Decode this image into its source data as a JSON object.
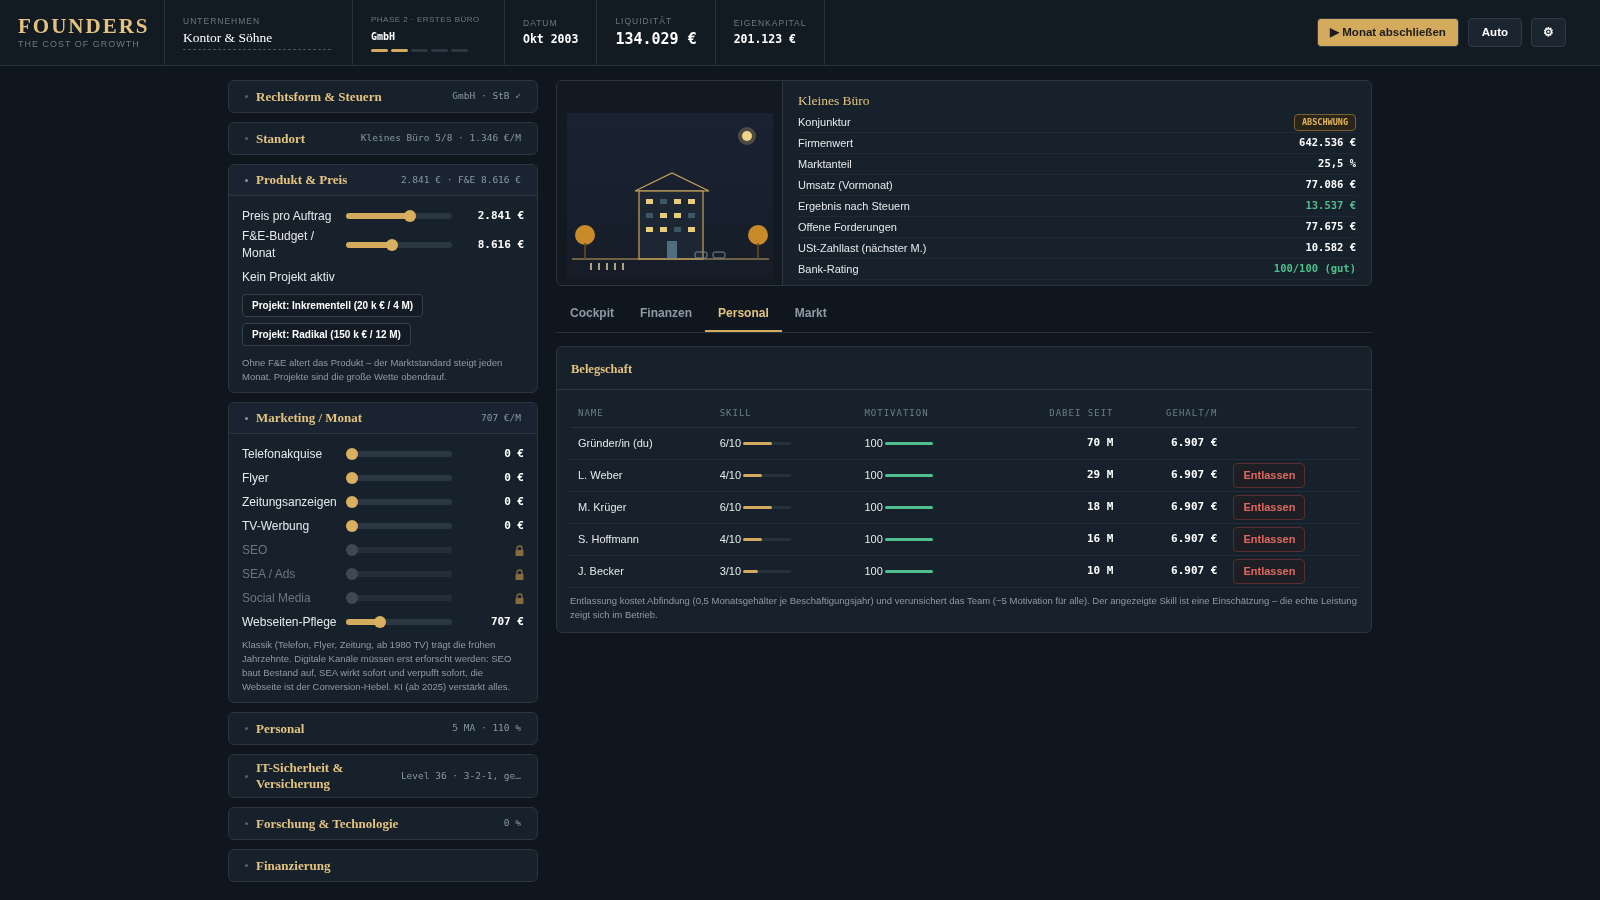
{
  "header": {
    "logo": {
      "title": "FOUNDERS",
      "subtitle": "THE COST OF GROWTH"
    },
    "company": {
      "label": "UNTERNEHMEN",
      "value": "Kontor & Söhne"
    },
    "phase": {
      "label": "PHASE 2 · ERSTES BÜRO",
      "value": "GmbH",
      "steps": [
        {
          "done": true
        },
        {
          "done": true
        },
        {
          "done": false
        },
        {
          "done": false
        },
        {
          "done": false
        }
      ]
    },
    "stats": [
      {
        "label": "DATUM",
        "value": "Okt 2003",
        "kind": "normal"
      },
      {
        "label": "LIQUIDITÄT",
        "value": "134.029 €",
        "kind": "large"
      },
      {
        "label": "EIGENKAPITAL",
        "value": "201.123 €",
        "kind": "normal"
      }
    ],
    "actions": [
      {
        "label": "▶ Monat abschließen",
        "kind": "primary"
      },
      {
        "label": "Auto",
        "kind": "secondary"
      },
      {
        "label": "⚙",
        "kind": "icon"
      }
    ]
  },
  "sidebar": {
    "sections": [
      {
        "title": "Rechtsform & Steuern",
        "summary": "GmbH · StB ✓",
        "expanded": false
      },
      {
        "title": "Standort",
        "summary": "Kleines Büro 5/8 · 1.346 €/M",
        "expanded": false
      },
      {
        "title": "Produkt & Preis",
        "summary": "2.841 € · F&E 8.616 €",
        "expanded": true,
        "sliders": [
          {
            "label": "Preis pro Auftrag",
            "level": 0.62,
            "value": "2.841 €",
            "kind": "active"
          },
          {
            "label": "F&E-Budget / Monat",
            "level": 0.43,
            "value": "8.616 €",
            "kind": "active"
          }
        ],
        "status": "Kein Projekt aktiv",
        "buttons": [
          "Projekt: Inkrementell (20 k € / 4 M)",
          "Projekt: Radikal (150 k € / 12 M)"
        ],
        "note": "Ohne F&E altert das Produkt – der Marktstandard steigt jeden Monat. Projekte sind die große Wette obendrauf."
      },
      {
        "title": "Marketing / Monat",
        "summary": "707 €/M",
        "expanded": true,
        "sliders": [
          {
            "label": "Telefonakquise",
            "level": 0,
            "value": "0 €",
            "kind": "active"
          },
          {
            "label": "Flyer",
            "level": 0,
            "value": "0 €",
            "kind": "active"
          },
          {
            "label": "Zeitungsanzeigen",
            "level": 0,
            "value": "0 €",
            "kind": "active"
          },
          {
            "label": "TV-Werbung",
            "level": 0,
            "value": "0 €",
            "kind": "active"
          },
          {
            "label": "SEO",
            "level": 0,
            "kind": "locked"
          },
          {
            "label": "SEA / Ads",
            "level": 0,
            "kind": "locked"
          },
          {
            "label": "Social Media",
            "level": 0,
            "kind": "locked"
          },
          {
            "label": "Webseiten-Pflege",
            "level": 0.3,
            "value": "707 €",
            "kind": "active"
          }
        ],
        "note": "Klassik (Telefon, Flyer, Zeitung, ab 1980 TV) trägt die frühen Jahrzehnte. Digitale Kanäle müssen erst erforscht werden: SEO baut Bestand auf, SEA wirkt sofort und verpufft sofort, die Webseite ist der Conversion-Hebel. KI (ab 2025) verstärkt alles."
      },
      {
        "title": "Personal",
        "summary": "5 MA · 110 %",
        "expanded": false
      },
      {
        "title": "IT-Sicherheit & Versicherung",
        "summary": "Level 36 · 3-2-1, ge…",
        "expanded": false
      },
      {
        "title": "Forschung & Technologie",
        "summary": "0 %",
        "expanded": false
      },
      {
        "title": "Finanzierung",
        "expanded": false
      }
    ]
  },
  "overview": {
    "title": "Kleines Büro",
    "rows": [
      {
        "label": "Konjunktur",
        "value": "ABSCHWUNG",
        "kind": "badge"
      },
      {
        "label": "Firmenwert",
        "value": "642.536 €",
        "kind": "plain"
      },
      {
        "label": "Marktanteil",
        "value": "25,5 %",
        "kind": "plain"
      },
      {
        "label": "Umsatz (Vormonat)",
        "value": "77.086 €",
        "kind": "plain"
      },
      {
        "label": "Ergebnis nach Steuern",
        "value": "13.537 €",
        "kind": "positive"
      },
      {
        "label": "Offene Forderungen",
        "value": "77.675 €",
        "kind": "plain"
      },
      {
        "label": "USt-Zahllast (nächster M.)",
        "value": "10.582 €",
        "kind": "plain"
      },
      {
        "label": "Bank-Rating",
        "value": "100/100 (gut)",
        "kind": "positive"
      }
    ]
  },
  "tabs": [
    {
      "label": "Cockpit",
      "selected": false
    },
    {
      "label": "Finanzen",
      "selected": false
    },
    {
      "label": "Personal",
      "selected": true
    },
    {
      "label": "Markt",
      "selected": false
    }
  ],
  "staff": {
    "title": "Belegschaft",
    "columns": [
      "NAME",
      "SKILL",
      "MOTIVATION",
      "DABEI SEIT",
      "GEHALT/M"
    ],
    "rows": [
      {
        "name": "Gründer/in (du)",
        "skill": {
          "text": "6/10",
          "level": 0.6
        },
        "motivation": {
          "text": "100",
          "level": 1
        },
        "since": "70 M",
        "salary": "6.907 €"
      },
      {
        "name": "L. Weber",
        "skill": {
          "text": "4/10",
          "level": 0.4
        },
        "motivation": {
          "text": "100",
          "level": 1
        },
        "since": "29 M",
        "salary": "6.907 €",
        "action": "Entlassen"
      },
      {
        "name": "M. Krüger",
        "skill": {
          "text": "6/10",
          "level": 0.6
        },
        "motivation": {
          "text": "100",
          "level": 1
        },
        "since": "18 M",
        "salary": "6.907 €",
        "action": "Entlassen"
      },
      {
        "name": "S. Hoffmann",
        "skill": {
          "text": "4/10",
          "level": 0.4
        },
        "motivation": {
          "text": "100",
          "level": 1
        },
        "since": "16 M",
        "salary": "6.907 €",
        "action": "Entlassen"
      },
      {
        "name": "J. Becker",
        "skill": {
          "text": "3/10",
          "level": 0.3
        },
        "motivation": {
          "text": "100",
          "level": 1
        },
        "since": "10 M",
        "salary": "6.907 €",
        "action": "Entlassen"
      }
    ],
    "note": "Entlassung kostet Abfindung (0,5 Monatsgehälter je Beschäftigungsjahr) und verunsichert das Team (−5 Motivation für alle). Der angezeigte Skill ist eine Einschätzung – die echte Leistung zeigt sich im Betrieb."
  }
}
